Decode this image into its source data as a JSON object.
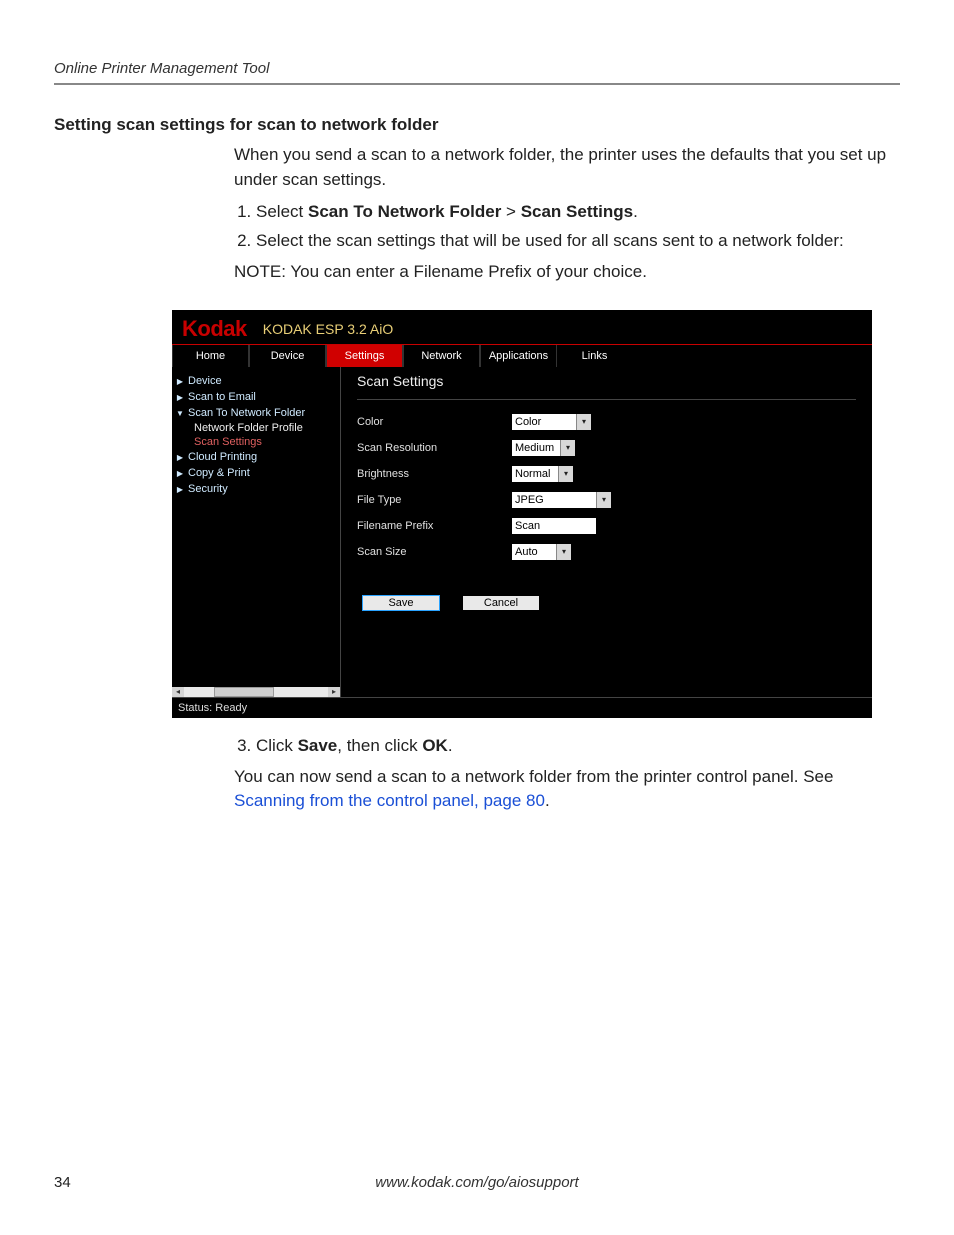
{
  "doc": {
    "running_header": "Online Printer Management Tool",
    "section_heading": "Setting scan settings for scan to network folder",
    "intro": "When you send a scan to a network folder, the printer uses the defaults that you set up under scan settings.",
    "step1_pre": "Select ",
    "step1_b1": "Scan To Network Folder",
    "step1_sep": " > ",
    "step1_b2": "Scan Settings",
    "step1_post": ".",
    "step2": "Select the scan settings that will be used for all scans sent to a network folder:",
    "note": "NOTE:  You can enter a Filename Prefix of your choice.",
    "step3_pre": "Click ",
    "step3_b1": "Save",
    "step3_mid": ", then click ",
    "step3_b2": "OK",
    "step3_post": ".",
    "after_pre": "You can now send a scan to a network folder from the printer control panel. See ",
    "after_link": "Scanning from the control panel, page 80",
    "after_post": ".",
    "footer_url": "www.kodak.com/go/aiosupport",
    "page_number": "34"
  },
  "app": {
    "brand": "Kodak",
    "title": "KODAK ESP 3.2 AiO",
    "tabs": {
      "home": "Home",
      "device": "Device",
      "settings": "Settings",
      "network": "Network",
      "applications": "Applications",
      "links": "Links"
    },
    "sidebar": {
      "device": "Device",
      "scan_to_email": "Scan to Email",
      "scan_to_network_folder": "Scan To Network Folder",
      "network_folder_profile": "Network Folder Profile",
      "scan_settings": "Scan Settings",
      "cloud_printing": "Cloud Printing",
      "copy_print": "Copy & Print",
      "security": "Security"
    },
    "content": {
      "title": "Scan Settings",
      "labels": {
        "color": "Color",
        "scan_resolution": "Scan Resolution",
        "brightness": "Brightness",
        "file_type": "File Type",
        "filename_prefix": "Filename Prefix",
        "scan_size": "Scan Size"
      },
      "values": {
        "color": "Color",
        "scan_resolution": "Medium",
        "brightness": "Normal",
        "file_type": "JPEG",
        "filename_prefix": "Scan",
        "scan_size": "Auto"
      },
      "buttons": {
        "save": "Save",
        "cancel": "Cancel"
      }
    },
    "status": "Status: Ready"
  }
}
